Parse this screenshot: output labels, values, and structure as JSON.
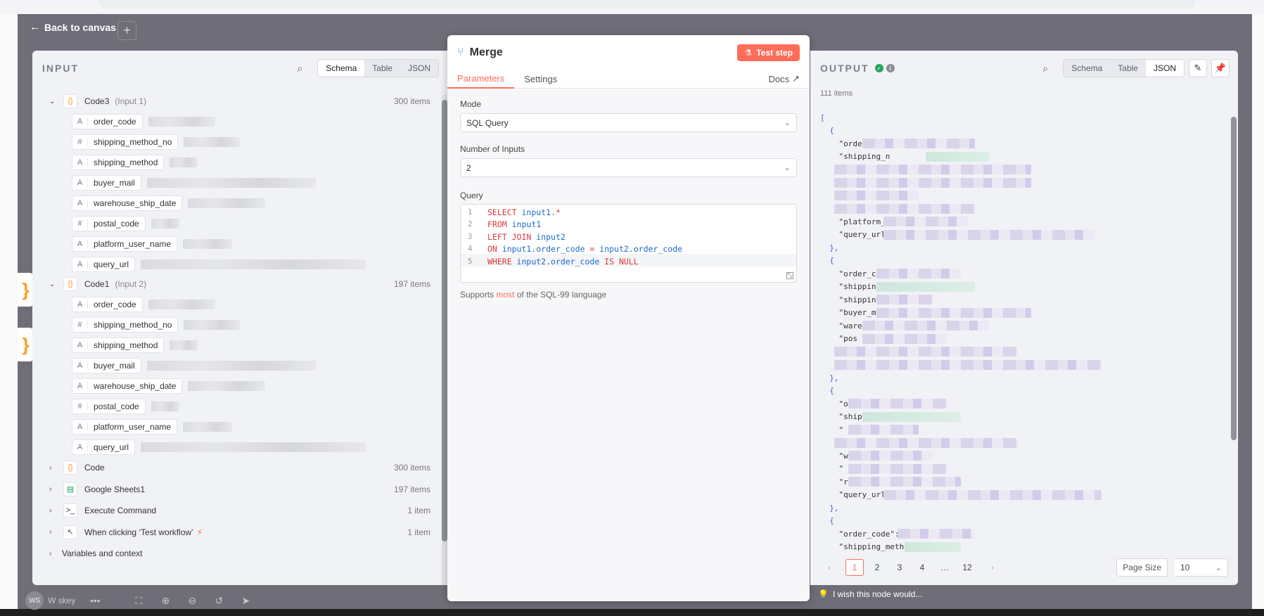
{
  "canvas": {
    "back_label": "Back to canvas",
    "plus": "+",
    "node_glyph": "}",
    "user_initials": "WS",
    "user_name": "W skey",
    "more": "•••"
  },
  "input": {
    "title": "INPUT",
    "view_tabs": [
      "Schema",
      "Table",
      "JSON"
    ],
    "active_tab": "Schema",
    "groups": [
      {
        "name": "Code3",
        "sub": "(Input 1)",
        "count": "300 items",
        "expanded": true,
        "type": "code",
        "fields": [
          {
            "t": "A",
            "name": "order_code",
            "blur": 95
          },
          {
            "t": "#",
            "name": "shipping_method_no",
            "blur": 80
          },
          {
            "t": "A",
            "name": "shipping_method",
            "blur": 40
          },
          {
            "t": "A",
            "name": "buyer_mail",
            "blur": 240
          },
          {
            "t": "A",
            "name": "warehouse_ship_date",
            "blur": 110
          },
          {
            "t": "#",
            "name": "postal_code",
            "blur": 40
          },
          {
            "t": "A",
            "name": "platform_user_name",
            "blur": 70
          },
          {
            "t": "A",
            "name": "query_url",
            "blur": 320
          }
        ]
      },
      {
        "name": "Code1",
        "sub": "(Input 2)",
        "count": "197 items",
        "expanded": true,
        "type": "code",
        "fields": [
          {
            "t": "A",
            "name": "order_code",
            "blur": 95
          },
          {
            "t": "#",
            "name": "shipping_method_no",
            "blur": 80
          },
          {
            "t": "A",
            "name": "shipping_method",
            "blur": 40
          },
          {
            "t": "A",
            "name": "buyer_mail",
            "blur": 240
          },
          {
            "t": "A",
            "name": "warehouse_ship_date",
            "blur": 110
          },
          {
            "t": "#",
            "name": "postal_code",
            "blur": 40
          },
          {
            "t": "A",
            "name": "platform_user_name",
            "blur": 70
          },
          {
            "t": "A",
            "name": "query_url",
            "blur": 320
          }
        ]
      }
    ],
    "collapsed": [
      {
        "name": "Code",
        "count": "300 items",
        "type": "code",
        "glyph": "{}"
      },
      {
        "name": "Google Sheets1",
        "count": "197 items",
        "type": "sheets",
        "glyph": "▤"
      },
      {
        "name": "Execute Command",
        "count": "1 item",
        "type": "cmd",
        "glyph": ">_"
      },
      {
        "name": "When clicking ‘Test workflow’",
        "count": "1 item",
        "type": "click",
        "glyph": "↖",
        "bolt": true
      }
    ],
    "variables_label": "Variables and context"
  },
  "node": {
    "title": "Merge",
    "test_label": "Test step",
    "tabs": [
      "Parameters",
      "Settings"
    ],
    "active_tab": "Parameters",
    "docs_label": "Docs",
    "mode_label": "Mode",
    "mode_value": "SQL Query",
    "inputs_label": "Number of Inputs",
    "inputs_value": "2",
    "query_label": "Query",
    "query_lines": [
      [
        {
          "c": "kw",
          "t": "SELECT "
        },
        {
          "c": "id",
          "t": "input1"
        },
        {
          "c": "kw",
          "t": ".*"
        }
      ],
      [
        {
          "c": "kw",
          "t": "FROM "
        },
        {
          "c": "id",
          "t": "input1"
        }
      ],
      [
        {
          "c": "kw",
          "t": "LEFT JOIN "
        },
        {
          "c": "id",
          "t": "input2"
        }
      ],
      [
        {
          "c": "kw",
          "t": "ON "
        },
        {
          "c": "id",
          "t": "input1.order_code"
        },
        {
          "c": "kw",
          "t": " = "
        },
        {
          "c": "id",
          "t": "input2.order_code"
        }
      ],
      [
        {
          "c": "kw",
          "t": "WHERE "
        },
        {
          "c": "id",
          "t": "input2.order_code"
        },
        {
          "c": "kw",
          "t": " IS NULL"
        }
      ]
    ],
    "support_pre": "Supports ",
    "support_hl": "most",
    "support_post": " of the SQL-99 language",
    "wish_label": "I wish this node would..."
  },
  "output": {
    "title": "OUTPUT",
    "view_tabs": [
      "Schema",
      "Table",
      "JSON"
    ],
    "active_tab": "JSON",
    "items_count": "111 items",
    "json_lines": [
      "[",
      "  {",
      "    \"order",
      "    \"shipping_n",
      "",
      "",
      "",
      "",
      "    \"platform_us",
      "    \"query_url",
      "  },",
      "  {",
      "    \"order_co",
      "    \"shipping",
      "    \"shipping_",
      "    \"buyer_m",
      "    \"ware",
      "    \"pos",
      "",
      "",
      "  },",
      "  {",
      "    \"orc",
      "    \"ship",
      "    \"",
      "",
      "    \"wa",
      "    \"",
      "    \"r",
      "    \"query_url\"",
      "  },",
      "  {",
      "    \"order_code\":  \"",
      "    \"shipping_method_",
      "    \"shipping_method\""
    ],
    "pages": [
      "1",
      "2",
      "3",
      "4",
      "…",
      "12"
    ],
    "active_page": "1",
    "page_size_label": "Page Size",
    "page_size": "10"
  }
}
